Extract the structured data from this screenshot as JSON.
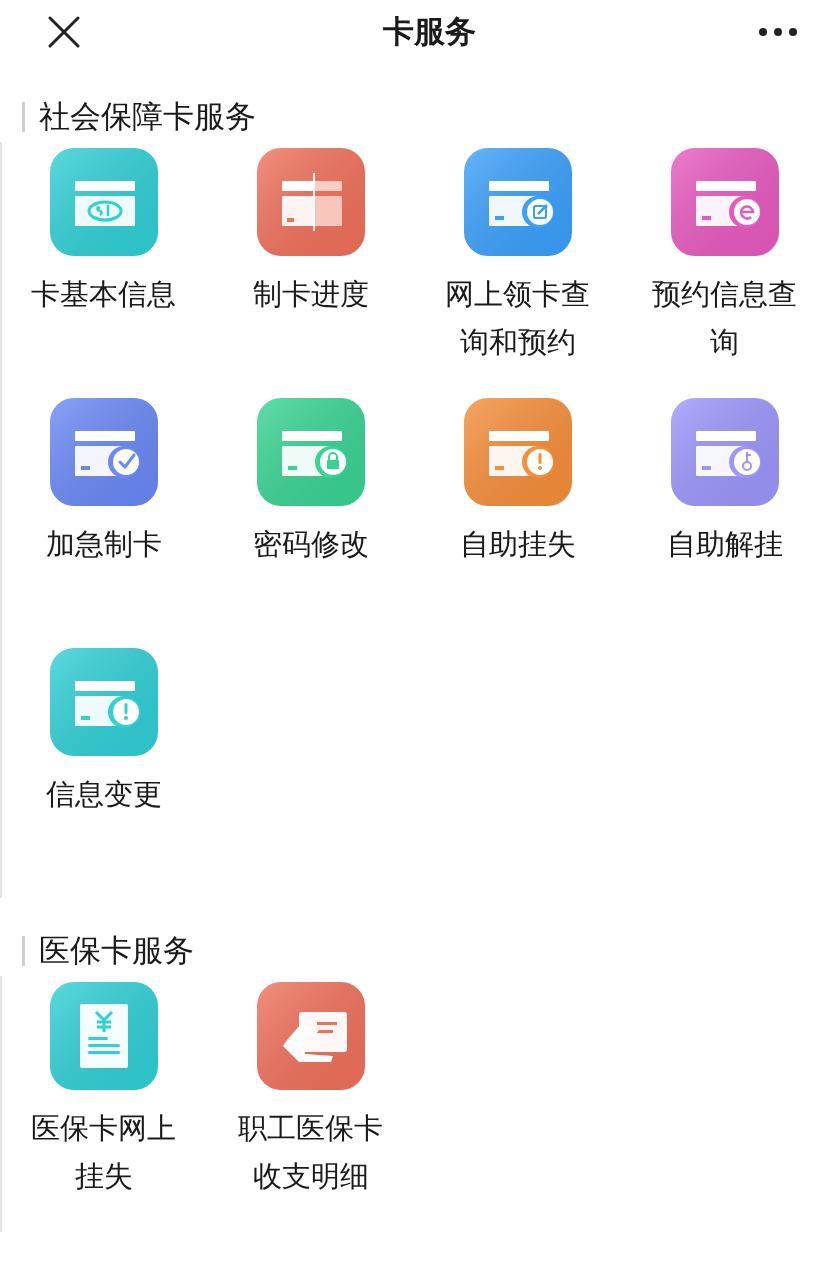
{
  "header": {
    "title": "卡服务"
  },
  "sections": [
    {
      "title": "社会保障卡服务",
      "items": [
        {
          "label": "卡基本信息",
          "kind": "si",
          "color": "#2fd0d6"
        },
        {
          "label": "制卡进度",
          "kind": "split",
          "color": "#f0705a"
        },
        {
          "label": "网上领卡查询和预约",
          "kind": "edit",
          "color": "#3aa0fb"
        },
        {
          "label": "预约信息查询",
          "kind": "web",
          "color": "#e859c0"
        },
        {
          "label": "加急制卡",
          "kind": "check",
          "color": "#6a88f6"
        },
        {
          "label": "密码修改",
          "kind": "lock",
          "color": "#38d494"
        },
        {
          "label": "自助挂失",
          "kind": "alert",
          "color": "#f68e3a"
        },
        {
          "label": "自助解挂",
          "kind": "key",
          "color": "#9c96fb"
        },
        {
          "label": "信息变更",
          "kind": "alert",
          "color": "#2fd0d6"
        }
      ]
    },
    {
      "title": "医保卡服务",
      "items": [
        {
          "label": "医保卡网上挂失",
          "kind": "receipt",
          "color": "#2fd0d6"
        },
        {
          "label": "职工医保卡收支明细",
          "kind": "hand",
          "color": "#f0705a"
        }
      ]
    }
  ]
}
